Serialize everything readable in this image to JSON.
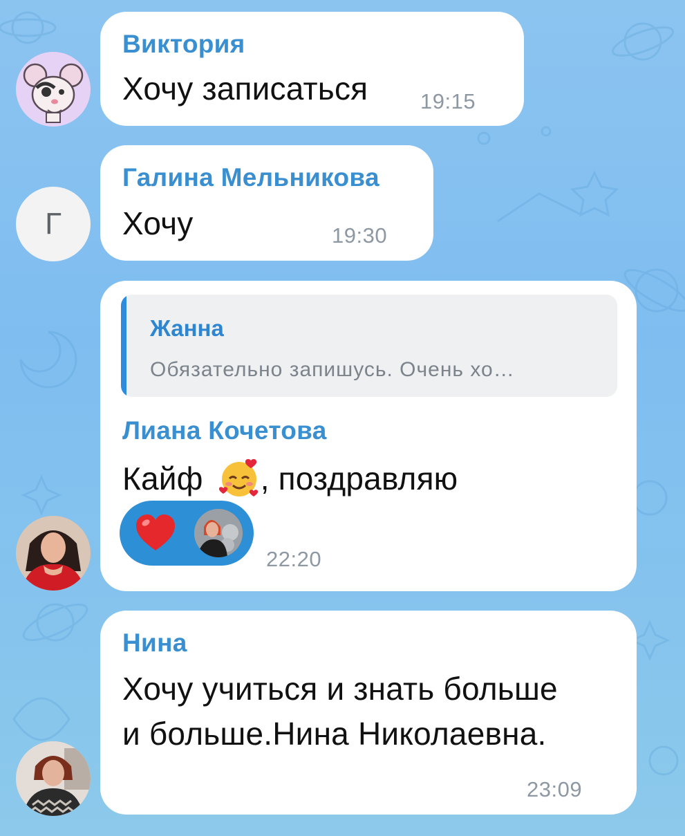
{
  "messages": [
    {
      "sender": "Виктория",
      "text": "Хочу записаться",
      "time": "19:15",
      "avatar": "rat-sticker-avatar"
    },
    {
      "sender": "Галина Мельникова",
      "text": "Хочу",
      "time": "19:30",
      "avatar_letter": "Г"
    },
    {
      "reply": {
        "sender": "Жанна",
        "text": "Обязательно запишусь. Очень хо…"
      },
      "sender": "Лиана Кочетова",
      "text_before_emoji": "Кайф",
      "emoji": "smiling-face-with-hearts",
      "text_after_emoji": ", поздравляю",
      "reactions": [
        {
          "emoji": "red-heart"
        }
      ],
      "time": "22:20"
    },
    {
      "sender": "Нина",
      "text_line1": "Хочу учиться и знать больше",
      "text_line2": "и больше.Нина Николаевна.",
      "time": "23:09"
    }
  ],
  "colors": {
    "accent": "#3a8fd0",
    "bubble": "#ffffff",
    "time": "#8e98a3",
    "reaction_bg": "#2d8fd6"
  }
}
